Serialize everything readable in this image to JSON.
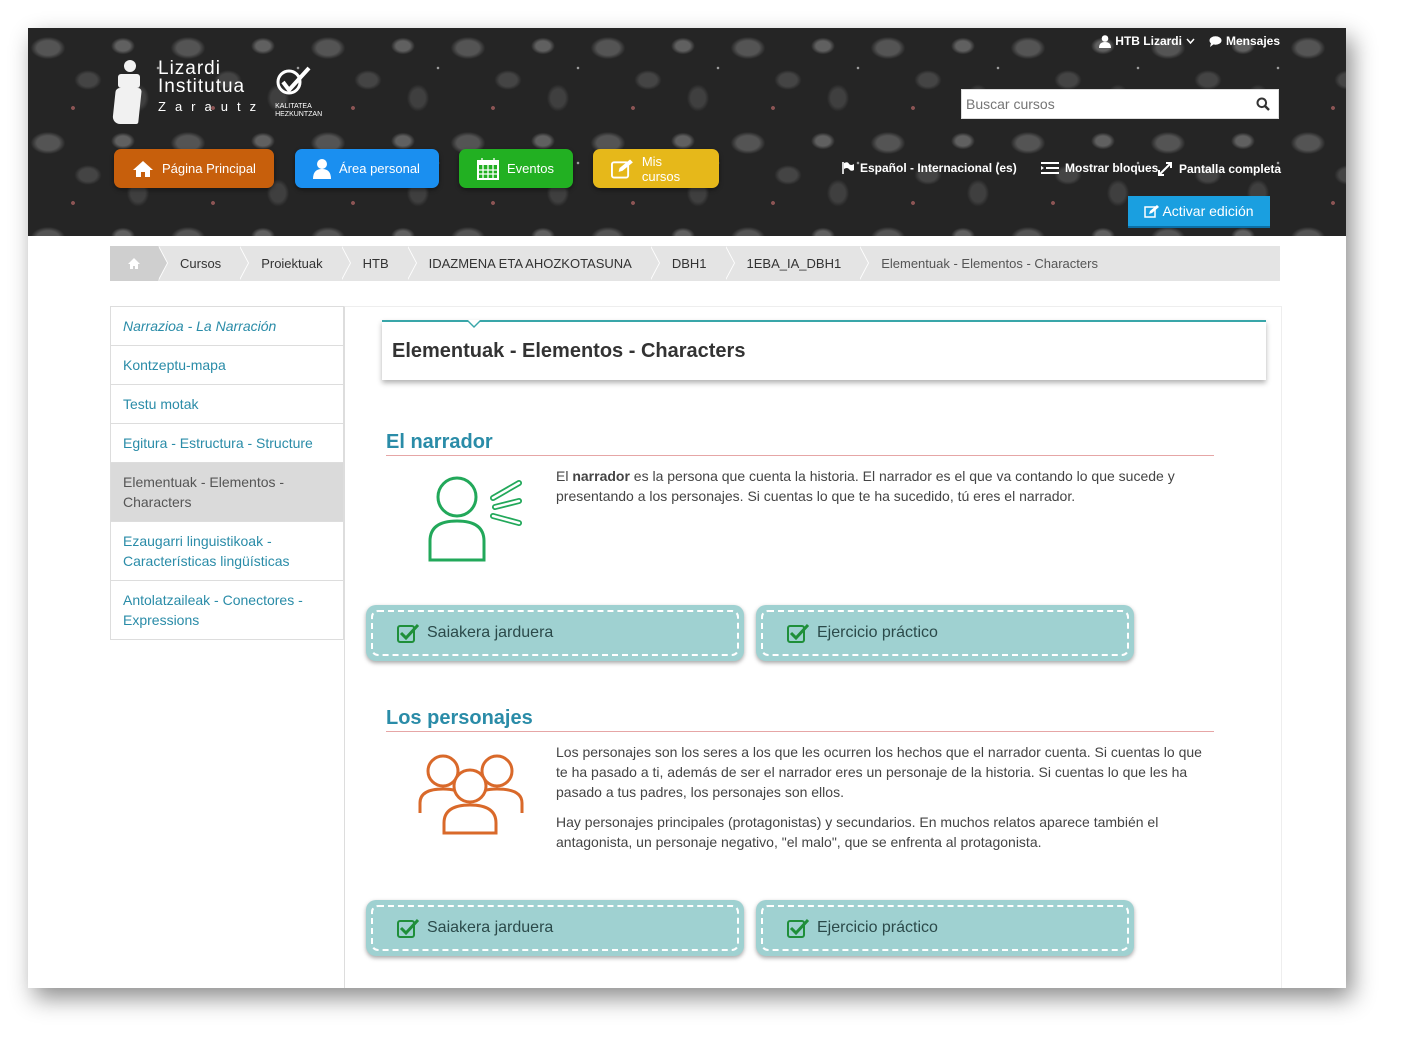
{
  "header": {
    "logo": {
      "line1": "Lizardi",
      "line2": "Institutua",
      "line3": "Zarautz",
      "badge_line1": "KALITATEA",
      "badge_line2": "HEZKUNTZAN"
    },
    "user": "HTB Lizardi",
    "messages": "Mensajes",
    "search_placeholder": "Buscar cursos",
    "nav": [
      {
        "label": "Página Principal",
        "icon": "home-icon",
        "color": "#c75f0c"
      },
      {
        "label": "Área personal",
        "icon": "user-icon",
        "color": "#1a8ff0"
      },
      {
        "label": "Eventos",
        "icon": "calendar-icon",
        "color": "#22b022"
      },
      {
        "label": "Mis cursos",
        "icon": "edit-icon",
        "color": "#e6b81a"
      }
    ],
    "language": "Español - Internacional (es)",
    "show_blocks": "Mostrar bloques",
    "fullscreen": "Pantalla completa",
    "edit_button": "Activar edición"
  },
  "breadcrumb": [
    "Cursos",
    "Proiektuak",
    "HTB",
    "IDAZMENA ETA AHOZKOTASUNA",
    "DBH1",
    "1EBA_IA_DBH1",
    "Elementuak - Elementos - Characters"
  ],
  "sidebar": {
    "items": [
      {
        "label": "Narrazioa - La Narración"
      },
      {
        "label": "Kontzeptu-mapa"
      },
      {
        "label": "Testu motak"
      },
      {
        "label": "Egitura - Estructura - Structure"
      },
      {
        "label": "Elementuak - Elementos - Characters"
      },
      {
        "label": "Ezaugarri linguistikoak - Características lingüísticas"
      },
      {
        "label": "Antolatzaileak - Conectores - Expressions"
      }
    ]
  },
  "main": {
    "title": "Elementuak - Elementos - Characters",
    "sections": [
      {
        "heading": "El narrador",
        "para1_prefix": "El ",
        "para1_bold": "narrador",
        "para1_rest": " es la persona que cuenta la historia. El narrador es el que va contando lo que sucede y presentando a los personajes. Si cuentas lo que te ha sucedido, tú eres el narrador.",
        "buttons": [
          "Saiakera jarduera",
          "Ejercicio práctico"
        ],
        "icon_color": "#22a85a"
      },
      {
        "heading": "Los personajes",
        "para1": "Los personajes son los seres a los que les ocurren los hechos que el narrador cuenta. Si cuentas lo que te ha pasado a ti, además de ser el narrador eres un personaje de la historia. Si cuentas lo que les ha pasado a tus padres, los personajes son ellos.",
        "para2": "Hay personajes principales (protagonistas) y secundarios. En muchos relatos aparece también el antagonista, un personaje negativo, \"el malo\", que se enfrenta al protagonista.",
        "buttons": [
          "Saiakera jarduera",
          "Ejercicio práctico"
        ],
        "icon_color": "#d9692a"
      }
    ]
  }
}
